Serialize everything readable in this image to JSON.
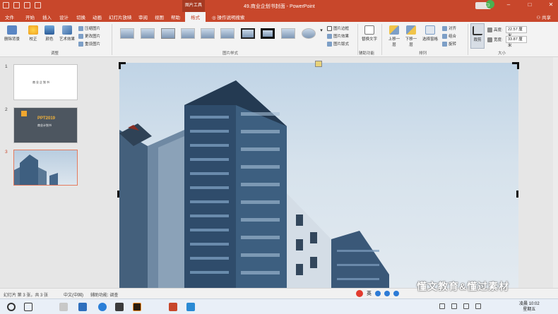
{
  "titlebar": {
    "context_tool": "图片工具",
    "document_title": "49.商业企划书封面 - PowerPoint",
    "user": "登录"
  },
  "tabs": [
    {
      "label": "文件"
    },
    {
      "label": "开始"
    },
    {
      "label": "插入"
    },
    {
      "label": "设计"
    },
    {
      "label": "切换"
    },
    {
      "label": "动画"
    },
    {
      "label": "幻灯片放映"
    },
    {
      "label": "审阅"
    },
    {
      "label": "视图"
    },
    {
      "label": "帮助"
    },
    {
      "label": "格式",
      "active": true
    }
  ],
  "tell_me": "操作说明搜索",
  "share": "共享",
  "ribbon": {
    "remove_background": "删除背景",
    "corrections": "校正",
    "color": "颜色",
    "artistic_effects": "艺术效果",
    "compress": "压缩图片",
    "change_picture": "更改图片",
    "reset_picture": "重设图片",
    "adjust_group": "调整",
    "styles_group": "图片样式",
    "border": "图片边框",
    "effects": "图片效果",
    "layout": "图片版式",
    "alt_text": "替换文字",
    "accessibility_group": "辅助功能",
    "align": "对齐",
    "group": "组合",
    "rotate": "旋转",
    "bring_forward": "上移一层",
    "send_backward": "下移一层",
    "selection_pane": "选择窗格",
    "arrange_group": "排列",
    "crop": "裁剪",
    "height_label": "高度:",
    "height_value": "22.57 厘米",
    "width_label": "宽度:",
    "width_value": "33.87 厘米",
    "size_group": "大小"
  },
  "slides": [
    {
      "number": "1",
      "text": "商业企划书"
    },
    {
      "number": "2",
      "title": "PPT2019",
      "subtitle": "商业计划书"
    },
    {
      "number": "3"
    }
  ],
  "status": {
    "slide_info": "幻灯片 第 3 张，共 3 张",
    "language": "中文(中国)",
    "accessibility": "辅助功能: 调查"
  },
  "ime_label": "英",
  "watermark": "懂文教育&懂过素材",
  "clock": {
    "time": "10:02",
    "day": "星期五",
    "prefix": "凌晨"
  },
  "colors": {
    "accent": "#c8472b",
    "selection": "#e37a5e",
    "ribbon_bg": "#f3f3f3"
  }
}
